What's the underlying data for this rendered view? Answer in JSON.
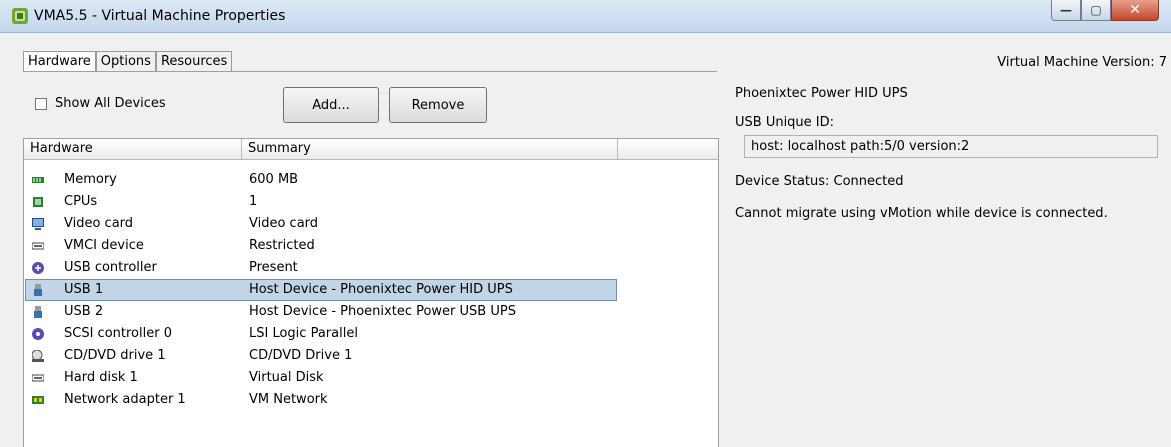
{
  "window": {
    "title": "VMA5.5 - Virtual Machine Properties"
  },
  "tabs": [
    "Hardware",
    "Options",
    "Resources"
  ],
  "version_label": "Virtual Machine Version: 7",
  "show_all_devices": {
    "label": "Show All Devices",
    "checked": false
  },
  "buttons": {
    "add": "Add...",
    "remove": "Remove"
  },
  "table": {
    "headers": [
      "Hardware",
      "Summary"
    ],
    "rows": [
      {
        "icon": "memory-icon",
        "name": "Memory",
        "summary": "600 MB"
      },
      {
        "icon": "cpu-icon",
        "name": "CPUs",
        "summary": "1"
      },
      {
        "icon": "monitor-icon",
        "name": "Video card",
        "summary": "Video card"
      },
      {
        "icon": "device-icon",
        "name": "VMCI device",
        "summary": "Restricted"
      },
      {
        "icon": "usb-controller-icon",
        "name": "USB controller",
        "summary": "Present"
      },
      {
        "icon": "usb-device-icon",
        "name": "USB 1",
        "summary": "Host Device - Phoenixtec Power HID UPS",
        "selected": true
      },
      {
        "icon": "usb-device-icon",
        "name": "USB 2",
        "summary": "Host Device - Phoenixtec Power USB UPS"
      },
      {
        "icon": "scsi-controller-icon",
        "name": "SCSI controller 0",
        "summary": "LSI Logic Parallel"
      },
      {
        "icon": "cd-drive-icon",
        "name": "CD/DVD drive 1",
        "summary": "CD/DVD Drive 1"
      },
      {
        "icon": "hard-disk-icon",
        "name": "Hard disk 1",
        "summary": "Virtual Disk"
      },
      {
        "icon": "network-adapter-icon",
        "name": "Network adapter 1",
        "summary": "VM Network"
      }
    ]
  },
  "details": {
    "title": "Phoenixtec Power HID UPS",
    "usb_id_label": "USB Unique ID:",
    "usb_id_value": "host: localhost path:5/0 version:2",
    "status": "Device Status: Connected",
    "note": "Cannot migrate using vMotion while device is connected."
  }
}
